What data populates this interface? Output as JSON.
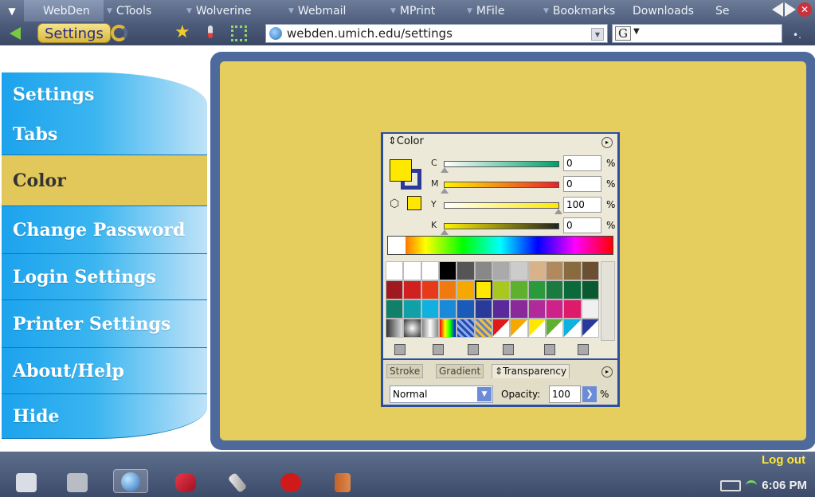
{
  "tabs": [
    {
      "label": "WebDen",
      "active": true
    },
    {
      "label": "CTools"
    },
    {
      "label": "Wolverine"
    },
    {
      "label": "Webmail"
    },
    {
      "label": "MPrint"
    },
    {
      "label": "MFile"
    },
    {
      "label": "Bookmarks"
    },
    {
      "label": "Downloads"
    },
    {
      "label": "Se"
    }
  ],
  "toolbar": {
    "page_label": "Settings",
    "url": "webden.umich.edu/settings",
    "search_engine": "G"
  },
  "sidebar": {
    "items": [
      {
        "label": "Settings"
      },
      {
        "label": "Tabs"
      },
      {
        "label": "Color",
        "active": true
      },
      {
        "label": "Change Password"
      },
      {
        "label": "Login Settings"
      },
      {
        "label": "Printer Settings"
      },
      {
        "label": "About/Help"
      },
      {
        "label": "Hide"
      }
    ]
  },
  "color_panel": {
    "title": "Color",
    "channels": [
      {
        "name": "C",
        "value": "0",
        "unit": "%"
      },
      {
        "name": "M",
        "value": "0",
        "unit": "%"
      },
      {
        "name": "Y",
        "value": "100",
        "unit": "%"
      },
      {
        "name": "K",
        "value": "0",
        "unit": "%"
      }
    ],
    "tabs": [
      "Stroke",
      "Gradient",
      "Transparency"
    ],
    "blend_mode": "Normal",
    "opacity_label": "Opacity:",
    "opacity_value": "100",
    "opacity_unit": "%"
  },
  "taskbar": {
    "logout": "Log out",
    "clock": "6:06 PM"
  },
  "colors": {
    "panel_bg": "#e5cd5e",
    "frame": "#4e6a9c",
    "sidebar_blue": "#1ca3ed",
    "logout": "#ffe83a"
  }
}
